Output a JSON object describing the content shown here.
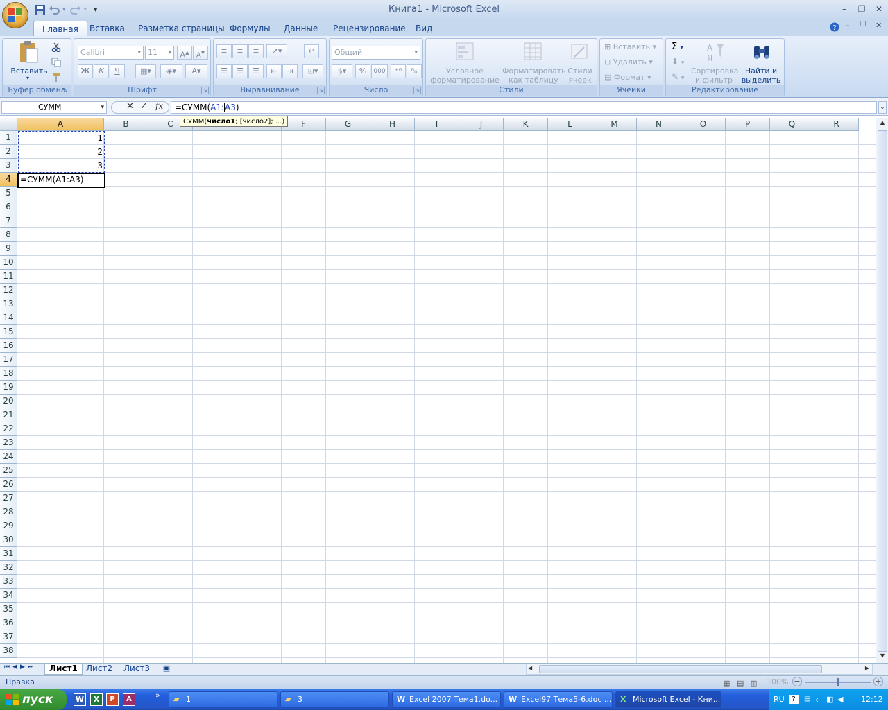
{
  "window": {
    "title": "Книга1 - Microsoft Excel"
  },
  "tabs": [
    "Главная",
    "Вставка",
    "Разметка страницы",
    "Формулы",
    "Данные",
    "Рецензирование",
    "Вид"
  ],
  "ribbon": {
    "clipboard": {
      "paste": "Вставить",
      "label": "Буфер обмена"
    },
    "font": {
      "name": "Calibri",
      "size": "11",
      "bold": "Ж",
      "italic": "К",
      "underline": "Ч",
      "label": "Шрифт"
    },
    "alignment": {
      "label": "Выравнивание"
    },
    "number": {
      "format": "Общий",
      "label": "Число"
    },
    "styles": {
      "cond1": "Условное",
      "cond2": "форматирование",
      "fmt1": "Форматировать",
      "fmt2": "как таблицу",
      "cell1": "Стили",
      "cell2": "ячеек",
      "label": "Стили"
    },
    "cells": {
      "insert": "Вставить",
      "delete": "Удалить",
      "format": "Формат",
      "label": "Ячейки"
    },
    "editing": {
      "sort1": "Сортировка",
      "sort2": "и фильтр",
      "find1": "Найти и",
      "find2": "выделить",
      "label": "Редактирование"
    }
  },
  "formula_bar": {
    "name_box": "СУММ",
    "formula_prefix": "=СУММ(",
    "formula_ref1": "A1:",
    "formula_ref2": "A3",
    "formula_suffix": ")"
  },
  "tooltip": {
    "prefix": "СУММ(",
    "bold": "число1",
    "suffix": "; [число2]; ...)"
  },
  "columns": [
    "A",
    "B",
    "C",
    "D",
    "E",
    "F",
    "G",
    "H",
    "I",
    "J",
    "K",
    "L",
    "M",
    "N",
    "O",
    "P",
    "Q",
    "R"
  ],
  "rows": [
    "1",
    "2",
    "3",
    "4",
    "5",
    "6",
    "7",
    "8",
    "9",
    "10",
    "11",
    "12",
    "13",
    "14",
    "15",
    "16",
    "17",
    "18",
    "19",
    "20",
    "21",
    "22",
    "23",
    "24",
    "25",
    "26",
    "27",
    "28",
    "29",
    "30",
    "31",
    "32",
    "33",
    "34",
    "35",
    "36",
    "37",
    "38"
  ],
  "cells": {
    "A1": "1",
    "A2": "2",
    "A3": "3",
    "A4": "=СУММ(A1:A3)"
  },
  "sheets": [
    "Лист1",
    "Лист2",
    "Лист3"
  ],
  "status": {
    "mode": "Правка",
    "zoom": "100%"
  },
  "taskbar": {
    "start": "пуск",
    "buttons": [
      "1",
      "3",
      "Excel 2007 Тема1.do...",
      "Excel97 Тема5-6.doc ...",
      "Microsoft Excel - Кни..."
    ],
    "lang": "RU",
    "time": "12:12"
  }
}
